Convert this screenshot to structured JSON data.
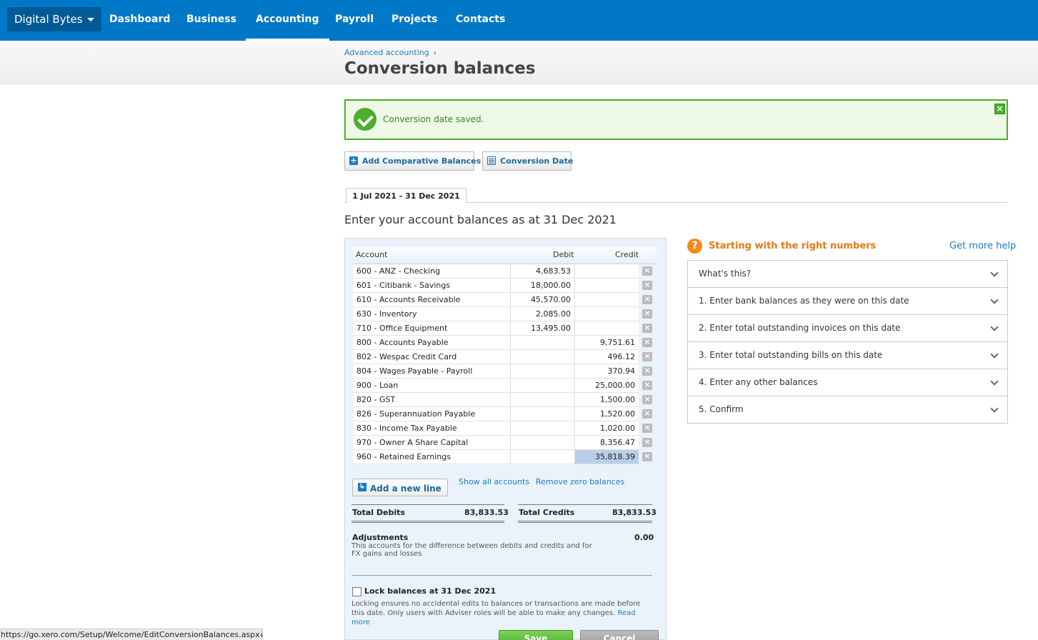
{
  "nav": {
    "org": "Digital Bytes",
    "items": [
      "Dashboard",
      "Business",
      "Accounting",
      "Payroll",
      "Projects",
      "Contacts"
    ],
    "active": "Accounting"
  },
  "breadcrumb": {
    "link": "Advanced accounting",
    "sep": "›"
  },
  "page_title": "Conversion balances",
  "alert": {
    "message": "Conversion date saved.",
    "close": "×"
  },
  "toolbar": {
    "add_comparative": "Add Comparative Balances",
    "conversion_date": "Conversion Date",
    "plus": "+"
  },
  "period_tab": "1 Jul 2021 - 31 Dec 2021",
  "subheading": "Enter your account balances as at 31 Dec 2021",
  "table": {
    "headers": {
      "account": "Account",
      "debit": "Debit",
      "credit": "Credit"
    },
    "delete_glyph": "×",
    "rows": [
      {
        "account": "600 - ANZ - Checking",
        "debit": "4,683.53",
        "credit": ""
      },
      {
        "account": "601 - Citibank - Savings",
        "debit": "18,000.00",
        "credit": ""
      },
      {
        "account": "610 - Accounts Receivable",
        "debit": "45,570.00",
        "credit": ""
      },
      {
        "account": "630 - Inventory",
        "debit": "2,085.00",
        "credit": ""
      },
      {
        "account": "710 - Office Equipment",
        "debit": "13,495.00",
        "credit": ""
      },
      {
        "account": "800 - Accounts Payable",
        "debit": "",
        "credit": "9,751.61"
      },
      {
        "account": "802 - Wespac Credit Card",
        "debit": "",
        "credit": "496.12"
      },
      {
        "account": "804 - Wages Payable - Payroll",
        "debit": "",
        "credit": "370.94"
      },
      {
        "account": "900 - Loan",
        "debit": "",
        "credit": "25,000.00"
      },
      {
        "account": "820 - GST",
        "debit": "",
        "credit": "1,500.00"
      },
      {
        "account": "826 - Superannuation Payable",
        "debit": "",
        "credit": "1,520.00"
      },
      {
        "account": "830 - Income Tax Payable",
        "debit": "",
        "credit": "1,020.00"
      },
      {
        "account": "970 - Owner A Share Capital",
        "debit": "",
        "credit": "8,356.47"
      },
      {
        "account": "960 - Retained Earnings",
        "debit": "",
        "credit": "35,818.39"
      }
    ]
  },
  "actions": {
    "add_line": "Add a new line",
    "add_line_icon": "↳",
    "show_all": "Show all accounts",
    "remove_zero": "Remove zero balances"
  },
  "totals": {
    "debits_label": "Total Debits",
    "debits_value": "83,833.53",
    "credits_label": "Total Credits",
    "credits_value": "83,833.53"
  },
  "adjustments": {
    "label": "Adjustments",
    "value": "0.00",
    "description": "This accounts for the difference between debits and credits and for FX gains and losses"
  },
  "lock": {
    "label": "Lock balances at 31 Dec 2021",
    "description": "Locking ensures no accidental edits to balances or transactions are made before this date. Only users with Adviser roles will be able to make any changes.",
    "read_more": "Read more"
  },
  "buttons": {
    "save": "Save",
    "cancel": "Cancel"
  },
  "help": {
    "icon": "?",
    "title": "Starting with the right numbers",
    "more": "Get more help",
    "items": [
      "What's this?",
      "1. Enter bank balances as they were on this date",
      "2. Enter total outstanding invoices on this date",
      "3. Enter total outstanding bills on this date",
      "4. Enter any other balances",
      "5. Confirm"
    ]
  },
  "status_url": "https://go.xero.com/Setup/Welcome/EditConversionBalances.aspx#",
  "colors": {
    "nav": "#0078c8",
    "accent": "#1a7dbf",
    "success": "#4cae2b",
    "help": "#f38a1c"
  }
}
